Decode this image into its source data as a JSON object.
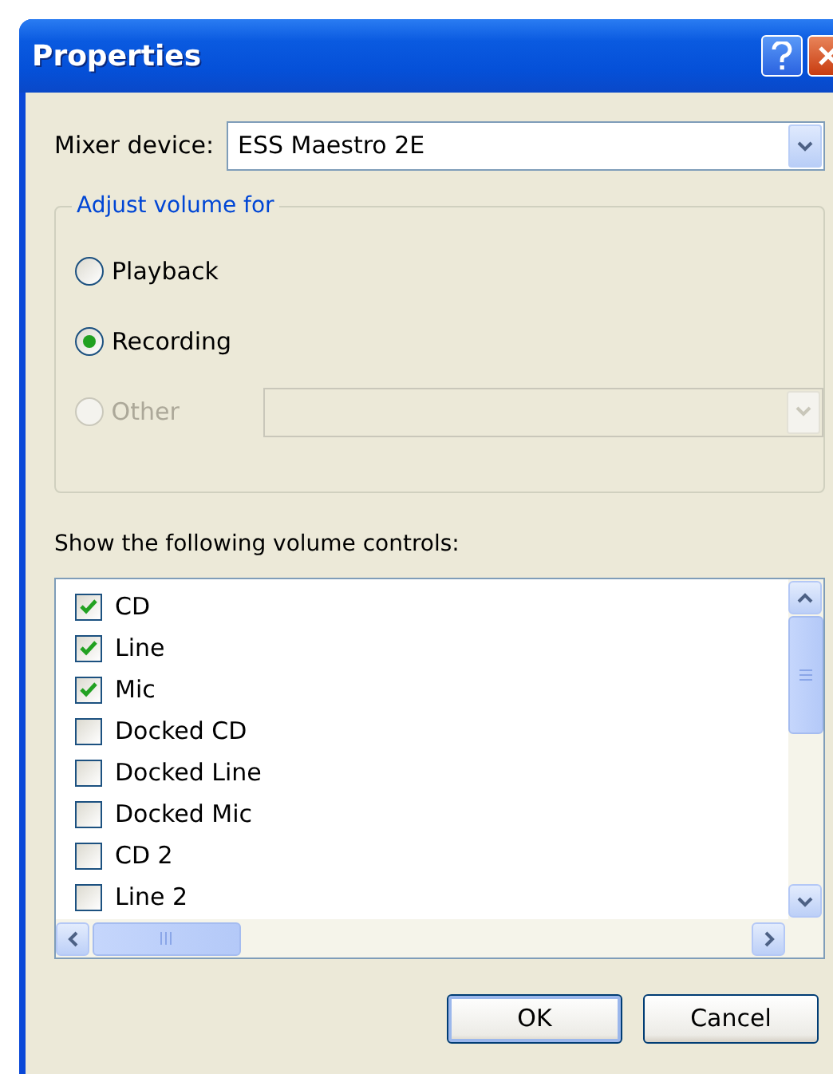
{
  "window": {
    "title": "Properties"
  },
  "mixer": {
    "label": "Mixer device:",
    "value": "ESS Maestro 2E"
  },
  "adjust_group": {
    "legend": "Adjust volume for",
    "options": [
      {
        "label": "Playback",
        "selected": false,
        "disabled": false
      },
      {
        "label": "Recording",
        "selected": true,
        "disabled": false
      },
      {
        "label": "Other",
        "selected": false,
        "disabled": true
      }
    ],
    "other_dropdown": {
      "disabled": true
    }
  },
  "controls_list": {
    "label": "Show the following volume controls:",
    "items": [
      {
        "label": "CD",
        "checked": true
      },
      {
        "label": "Line",
        "checked": true
      },
      {
        "label": "Mic",
        "checked": true
      },
      {
        "label": "Docked CD",
        "checked": false
      },
      {
        "label": "Docked Line",
        "checked": false
      },
      {
        "label": "Docked Mic",
        "checked": false
      },
      {
        "label": "CD 2",
        "checked": false
      },
      {
        "label": "Line 2",
        "checked": false
      }
    ]
  },
  "buttons": [
    {
      "label": "OK"
    },
    {
      "label": "Cancel"
    }
  ]
}
